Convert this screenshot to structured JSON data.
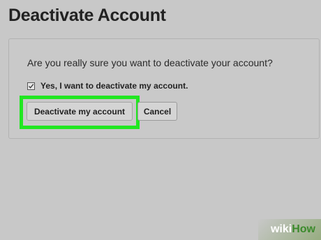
{
  "page": {
    "title": "Deactivate Account"
  },
  "dialog": {
    "question": "Are you really sure you want to deactivate your account?",
    "confirm_label": "Yes, I want to deactivate my account.",
    "confirm_checked": true,
    "deactivate_button": "Deactivate my account",
    "cancel_button": "Cancel",
    "highlight_color": "#21e721"
  },
  "watermark": {
    "part1": "wiki",
    "part2": "How"
  }
}
